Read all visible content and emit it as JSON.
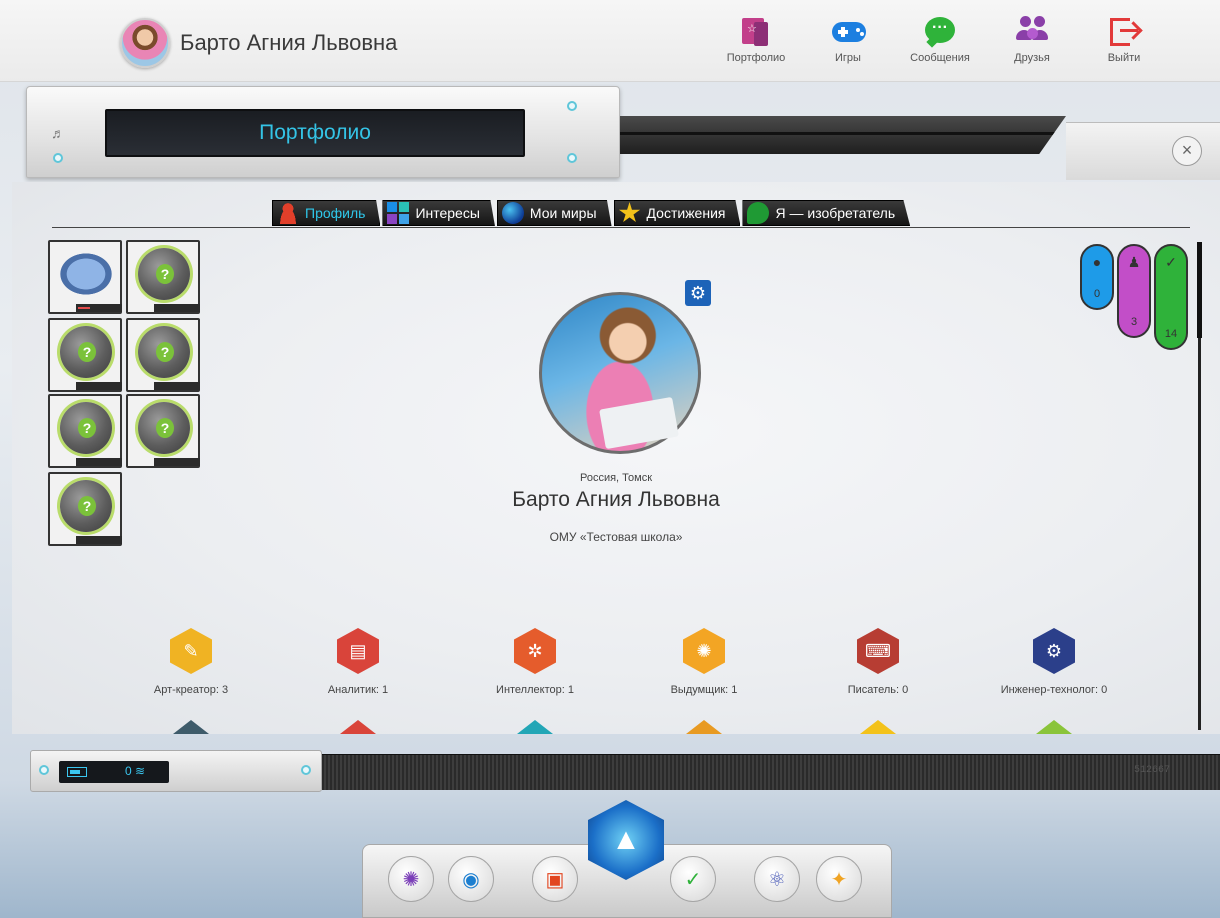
{
  "header": {
    "user_name": "Барто Агния Львовна",
    "nav": [
      {
        "label": "Портфолио",
        "icon": "portfolio-icon"
      },
      {
        "label": "Игры",
        "icon": "gamepad-icon"
      },
      {
        "label": "Сообщения",
        "icon": "chat-bubble-icon"
      },
      {
        "label": "Друзья",
        "icon": "friends-icon"
      },
      {
        "label": "Выйти",
        "icon": "exit-icon"
      }
    ]
  },
  "window": {
    "title": "Портфолио",
    "close_symbol": "×"
  },
  "tabs": [
    {
      "label": "Профиль",
      "active": true
    },
    {
      "label": "Интересы",
      "active": false
    },
    {
      "label": "Мои миры",
      "active": false
    },
    {
      "label": "Достижения",
      "active": false
    },
    {
      "label": "Я — изобретатель",
      "active": false
    }
  ],
  "stats": [
    {
      "icon": "planet-icon",
      "value": "0",
      "color": "#1e9be8"
    },
    {
      "icon": "person-icon",
      "value": "3",
      "color": "#c24ec8"
    },
    {
      "icon": "checkmark-icon",
      "value": "14",
      "color": "#2fb23a"
    }
  ],
  "profile": {
    "location": "Россия, Томск",
    "full_name": "Барто Агния Львовна",
    "school": "ОМУ «Тестовая школа»"
  },
  "skills": [
    {
      "label": "Арт-креатор: 3",
      "color": "#f0b323",
      "icon": "pencil-icon"
    },
    {
      "label": "Аналитик: 1",
      "color": "#d9443a",
      "icon": "newspaper-icon"
    },
    {
      "label": "Интеллектор: 1",
      "color": "#e55c2c",
      "icon": "network-icon"
    },
    {
      "label": "Выдумщик: 1",
      "color": "#f3a524",
      "icon": "lightbulb-icon"
    },
    {
      "label": "Писатель: 0",
      "color": "#b73d33",
      "icon": "typewriter-icon"
    },
    {
      "label": "Инженер-технолог: 0",
      "color": "#2b3f8a",
      "icon": "gears-icon"
    }
  ],
  "device": {
    "wifi_symbol": "0 ≋",
    "code": "512667"
  },
  "dock": [
    {
      "icon": "galaxy-icon"
    },
    {
      "icon": "globe-icon"
    },
    {
      "icon": "briefcase-icon"
    },
    {
      "icon": "checkmark-icon"
    },
    {
      "icon": "atom-icon"
    },
    {
      "icon": "lightbulb-icon"
    }
  ]
}
